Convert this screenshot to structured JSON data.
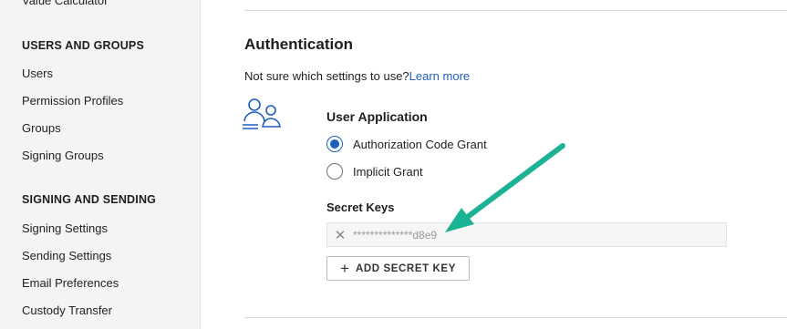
{
  "sidebar": {
    "partial_item": "Value Calculator",
    "sections": [
      {
        "heading": "USERS AND GROUPS",
        "items": [
          "Users",
          "Permission Profiles",
          "Groups",
          "Signing Groups"
        ]
      },
      {
        "heading": "SIGNING AND SENDING",
        "items": [
          "Signing Settings",
          "Sending Settings",
          "Email Preferences",
          "Custody Transfer"
        ]
      }
    ]
  },
  "main": {
    "title": "Authentication",
    "help_text": "Not sure which settings to use?",
    "help_link": "Learn more",
    "icon": "users-icon",
    "user_app": {
      "title": "User Application",
      "options": [
        {
          "label": "Authorization Code Grant",
          "selected": true
        },
        {
          "label": "Implicit Grant",
          "selected": false
        }
      ]
    },
    "secret_keys": {
      "label": "Secret Keys",
      "keys": [
        "**************d8e9"
      ],
      "remove_icon": "close-icon",
      "add_button": "ADD SECRET KEY",
      "add_icon": "plus-icon"
    }
  },
  "colors": {
    "accent": "#1d5fbf",
    "annotation_arrow": "#1bb394",
    "sidebar_bg": "#f4f4f4"
  }
}
